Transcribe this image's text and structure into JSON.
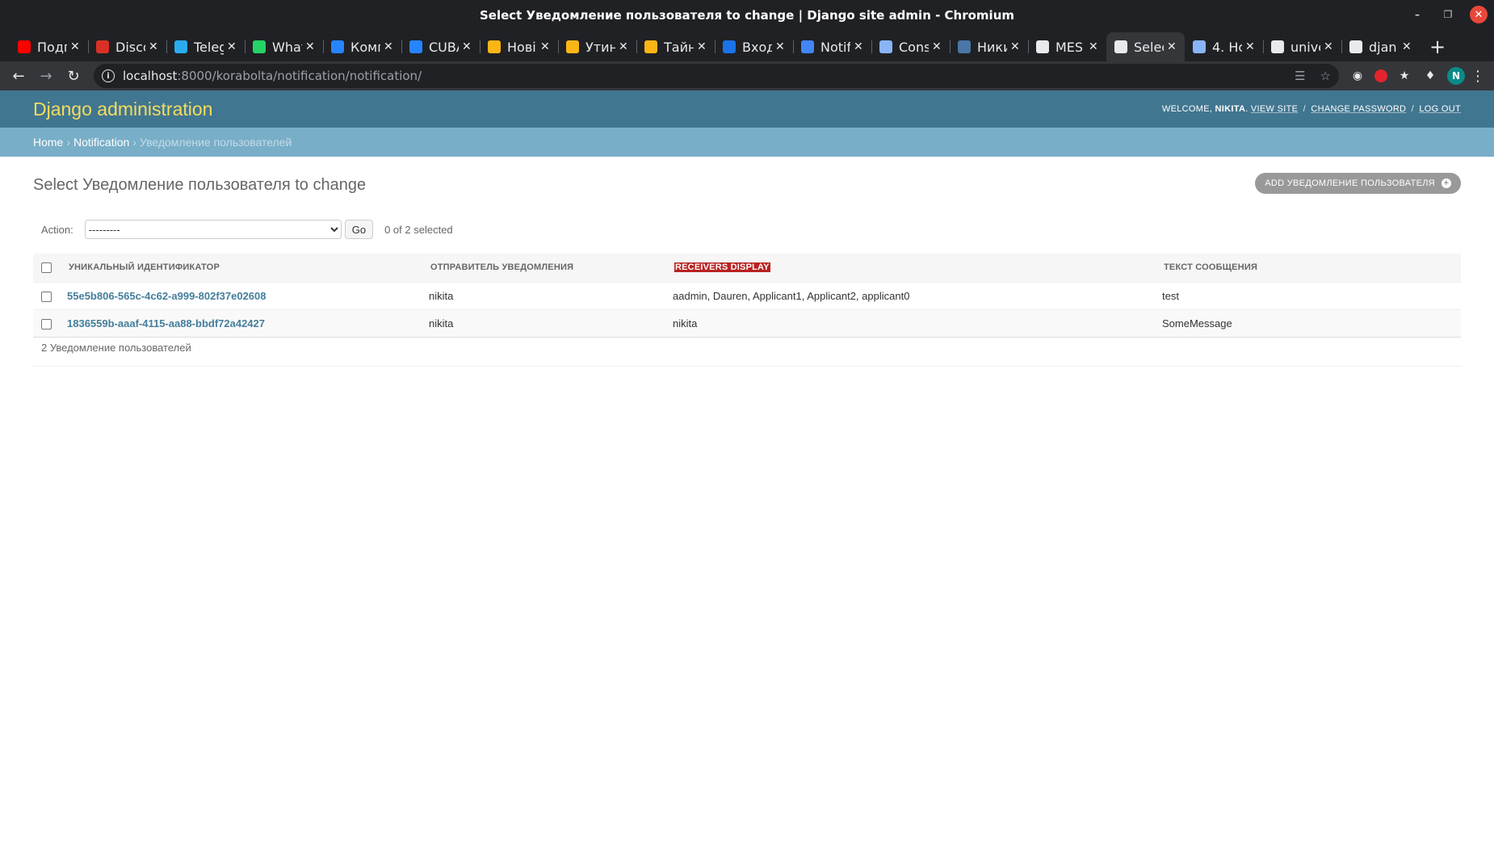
{
  "browser": {
    "window_title": "Select Уведомление пользователя to change | Django site admin - Chromium",
    "tabs": [
      {
        "label": "Подг",
        "favicon": "youtube-icon",
        "color": "#ff0000"
      },
      {
        "label": "Disco",
        "favicon": "calendar-icon",
        "color": "#d93025"
      },
      {
        "label": "Teleg",
        "favicon": "telegram-icon",
        "color": "#2aabee"
      },
      {
        "label": "What",
        "favicon": "whatsapp-icon",
        "color": "#25d366"
      },
      {
        "label": "Комг",
        "favicon": "jira-icon",
        "color": "#2684ff"
      },
      {
        "label": "CUBA",
        "favicon": "jira-icon",
        "color": "#2684ff"
      },
      {
        "label": "Нові",
        "favicon": "yandex-icon",
        "color": "#fbb616"
      },
      {
        "label": "Утин",
        "favicon": "yandex-icon",
        "color": "#fbb616"
      },
      {
        "label": "Тайн",
        "favicon": "yandex-icon",
        "color": "#fbb616"
      },
      {
        "label": "Вход",
        "favicon": "mail-icon",
        "color": "#1a73e8"
      },
      {
        "label": "Notif",
        "favicon": "docs-icon",
        "color": "#4285f4"
      },
      {
        "label": "Cons",
        "favicon": "book-icon",
        "color": "#8ab4f8"
      },
      {
        "label": "Ники",
        "favicon": "vk-icon",
        "color": "#4a76a8"
      },
      {
        "label": "MES",
        "favicon": "globe-icon",
        "color": "#e8eaed"
      },
      {
        "label": "Selec",
        "favicon": "globe-icon",
        "color": "#e8eaed",
        "active": true
      },
      {
        "label": "4. Hc",
        "favicon": "book-icon",
        "color": "#8ab4f8"
      },
      {
        "label": "unive",
        "favicon": "github-icon",
        "color": "#e8eaed"
      },
      {
        "label": "djan",
        "favicon": "google-icon",
        "color": "#e8eaed"
      }
    ],
    "url_host": "localhost",
    "url_path": ":8000/korabolta/notification/notification/",
    "profile_initial": "N"
  },
  "admin": {
    "branding": "Django administration",
    "user_tools": {
      "welcome": "Welcome,",
      "username": "nikita",
      "view_site": "View site",
      "change_password": "Change password",
      "log_out": "Log out"
    },
    "breadcrumbs": {
      "home": "Home",
      "app": "Notification",
      "current": "Уведомление пользователей"
    },
    "page_title": "Select Уведомление пользователя to change",
    "add_button": "Add Уведомление пользователя",
    "action_label": "Action:",
    "action_selected": "---------",
    "go_button": "Go",
    "selection_counter": "0 of 2 selected",
    "columns": [
      "Уникальный идентификатор",
      "Отправитель уведомления",
      "Receivers display",
      "Текст сообщения"
    ],
    "rows": [
      {
        "id": "55e5b806-565c-4c62-a999-802f37e02608",
        "sender": "nikita",
        "receivers": "aadmin, Dauren, Applicant1, Applicant2, applicant0",
        "text": "test"
      },
      {
        "id": "1836559b-aaaf-4115-aa88-bbdf72a42427",
        "sender": "nikita",
        "receivers": "nikita",
        "text": "SomeMessage"
      }
    ],
    "result_count": "2 Уведомление пользователей",
    "colors": {
      "header_bg": "#417690",
      "branding": "#f5dd5d",
      "breadcrumbs_bg": "#79aec8",
      "link": "#447e9b",
      "highlight": "#ba2121"
    }
  }
}
